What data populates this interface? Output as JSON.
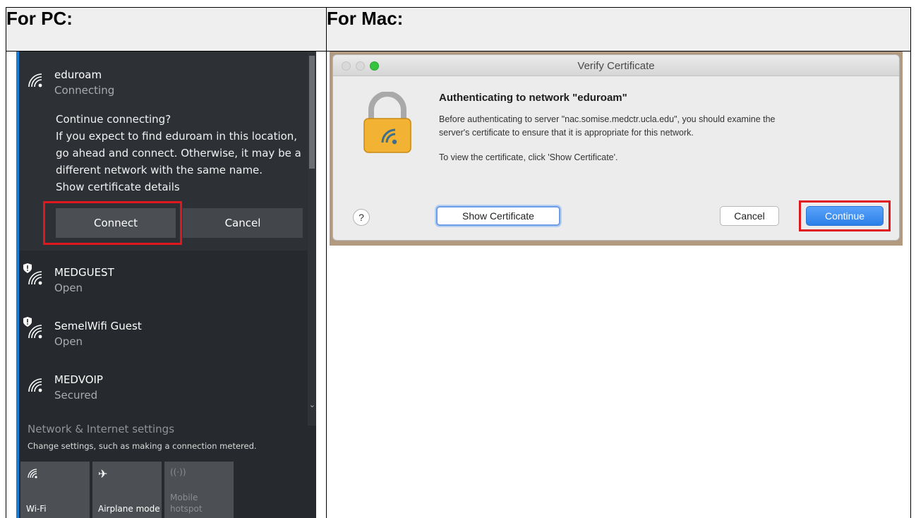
{
  "intro": {
    "text": "",
    "link": ""
  },
  "table": {
    "pc_header": "For PC:",
    "mac_header": "For Mac:"
  },
  "windows": {
    "connecting_network": {
      "name": "eduroam",
      "status": "Connecting"
    },
    "prompt_lines": [
      "Continue connecting?",
      "If you expect to find eduroam in this location,",
      "go ahead and connect. Otherwise, it may be a",
      "different network with the same name.",
      "Show certificate details"
    ],
    "connect_label": "Connect",
    "cancel_label": "Cancel",
    "networks": [
      {
        "name": "MEDGUEST",
        "status": "Open"
      },
      {
        "name": "SemelWifi Guest",
        "status": "Open"
      },
      {
        "name": "MEDVOIP",
        "status": "Secured"
      }
    ],
    "settings_title": "Network & Internet settings",
    "settings_sub": "Change settings, such as making a connection metered.",
    "tiles": [
      {
        "icon": "wifi-icon",
        "label": "Wi-Fi"
      },
      {
        "icon": "airplane-icon",
        "label": "Airplane mode"
      },
      {
        "icon": "hotspot-icon",
        "label_line1": "Mobile",
        "label_line2": "hotspot"
      }
    ],
    "highlight_color": "#e0181e",
    "accent_color": "#1a7fd4"
  },
  "mac": {
    "window_title": "Verify Certificate",
    "heading": "Authenticating to network \"eduroam\"",
    "body_lines": [
      "Before authenticating to server \"nac.somise.medctr.ucla.edu\", you should examine the",
      "server's certificate to ensure that it is appropriate for this network."
    ],
    "view_text": "To view the certificate, click 'Show Certificate'.",
    "help_label": "?",
    "show_certificate_label": "Show Certificate",
    "cancel_label": "Cancel",
    "continue_label": "Continue",
    "accent_color": "#2c7fe9"
  }
}
